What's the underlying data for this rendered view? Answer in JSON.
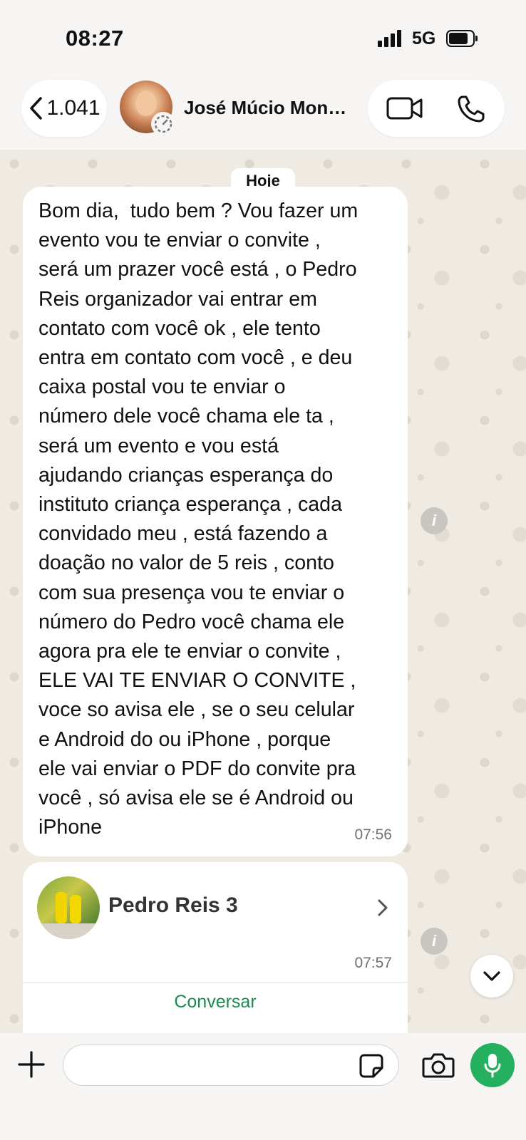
{
  "status_bar": {
    "time": "08:27",
    "network": "5G"
  },
  "header": {
    "back_count": "1.041",
    "contact_name": "José Múcio Mon…"
  },
  "chat": {
    "date_label": "Hoje",
    "message": {
      "text": "Bom dia,  tudo bem ? Vou fazer um\nevento vou te enviar o convite ,\nserá um prazer você está , o Pedro\nReis organizador vai entrar em\ncontato com você ok , ele tento\nentra em contato com você , e deu\ncaixa postal vou te enviar o\nnúmero dele você chama ele ta ,\nserá um evento e vou está\najudando crianças esperança do\ninstituto criança esperança , cada\nconvidado meu , está fazendo a\ndoação no valor de 5 reis , conto\ncom sua presença vou te enviar o\nnúmero do Pedro você chama ele\nagora pra ele te enviar o convite ,\nELE VAI TE ENVIAR O CONVITE ,\nvoce so avisa ele , se o seu celular\ne Android do ou iPhone , porque\nele vai enviar o PDF do convite pra\nvocê , só avisa ele se é Android ou\niPhone",
      "time": "07:56"
    },
    "contact_card": {
      "name": "Pedro Reis 3",
      "time": "07:57",
      "action_label": "Conversar"
    }
  },
  "input_bar": {
    "placeholder": ""
  },
  "colors": {
    "accent_green": "#25b060",
    "link_green": "#1a8c4e",
    "chat_bg": "#efeae2"
  },
  "icons": [
    "chevron-left-icon",
    "status-update-icon",
    "video-call-icon",
    "phone-icon",
    "info-icon",
    "chevron-right-icon",
    "chevron-down-icon",
    "plus-icon",
    "sticker-icon",
    "camera-icon",
    "microphone-icon"
  ]
}
